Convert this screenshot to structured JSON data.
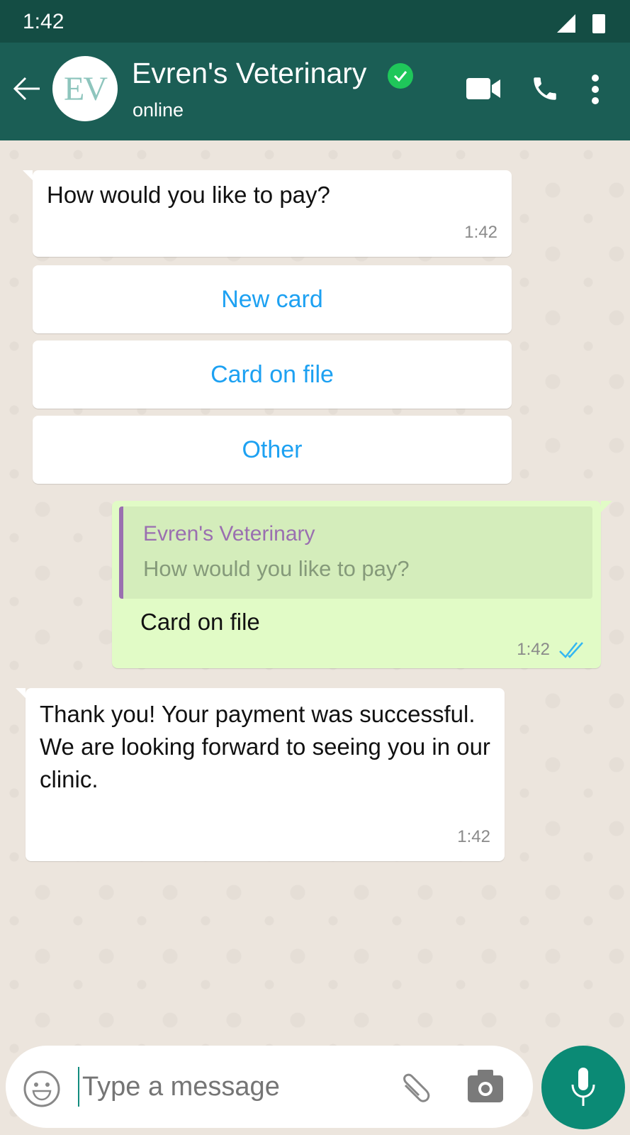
{
  "status_bar": {
    "time": "1:42"
  },
  "header": {
    "avatar_initials": "EV",
    "title": "Evren's Veterinary",
    "subtitle": "online",
    "verified": true
  },
  "messages": [
    {
      "direction": "incoming",
      "text": "How would you like to pay?",
      "time": "1:42"
    },
    {
      "direction": "outgoing",
      "quote_author": "Evren's Veterinary",
      "quote_text": "How would you like to pay?",
      "text": "Card on file",
      "time": "1:42",
      "status": "read"
    },
    {
      "direction": "incoming",
      "text": "Thank you! Your payment was successful. We are looking forward to seeing you in our clinic.",
      "time": "1:42"
    }
  ],
  "quick_replies": [
    {
      "label": "New card"
    },
    {
      "label": "Card on file"
    },
    {
      "label": "Other"
    }
  ],
  "composer": {
    "placeholder": "Type a message"
  },
  "colors": {
    "header": "#1b5e55",
    "status_bar": "#144d44",
    "accent": "#0b8a75",
    "link": "#1da1f2",
    "outgoing_bubble": "#e1fbc6",
    "quote_author": "#9a6fb0"
  }
}
